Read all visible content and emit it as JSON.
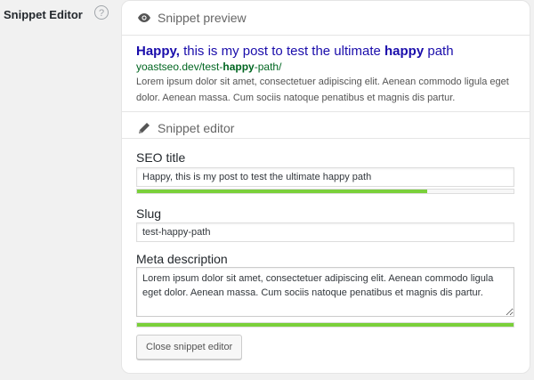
{
  "field": {
    "label": "Snippet Editor",
    "help_icon": "?"
  },
  "preview_section": {
    "heading": "Snippet preview",
    "icon": "eye-icon"
  },
  "preview": {
    "title_parts": [
      {
        "text": "Happy,",
        "bold": true
      },
      {
        "text": " this is my post to test the ultimate ",
        "bold": false
      },
      {
        "text": "happy",
        "bold": true
      },
      {
        "text": " path",
        "bold": false
      }
    ],
    "url_parts": [
      {
        "text": "yoastseo.dev/test-",
        "bold": false
      },
      {
        "text": "happy",
        "bold": true
      },
      {
        "text": "-path/",
        "bold": false
      }
    ],
    "description": "Lorem ipsum dolor sit amet, consectetuer adipiscing elit. Aenean commodo ligula eget dolor. Aenean massa. Cum sociis natoque penatibus et magnis dis partur."
  },
  "editor_section": {
    "heading": "Snippet editor",
    "icon": "pencil-icon"
  },
  "editor": {
    "seo_title": {
      "label": "SEO title",
      "value": "Happy, this is my post to test the ultimate happy path",
      "progress_percent": 77,
      "progress_color": "#7ad03a"
    },
    "slug": {
      "label": "Slug",
      "value": "test-happy-path"
    },
    "meta_description": {
      "label": "Meta description",
      "value": "Lorem ipsum dolor sit amet, consectetuer adipiscing elit. Aenean commodo ligula eget dolor. Aenean massa. Cum sociis natoque penatibus et magnis dis partur.",
      "progress_percent": 100,
      "progress_color": "#7ad03a"
    },
    "close_button_label": "Close snippet editor"
  }
}
